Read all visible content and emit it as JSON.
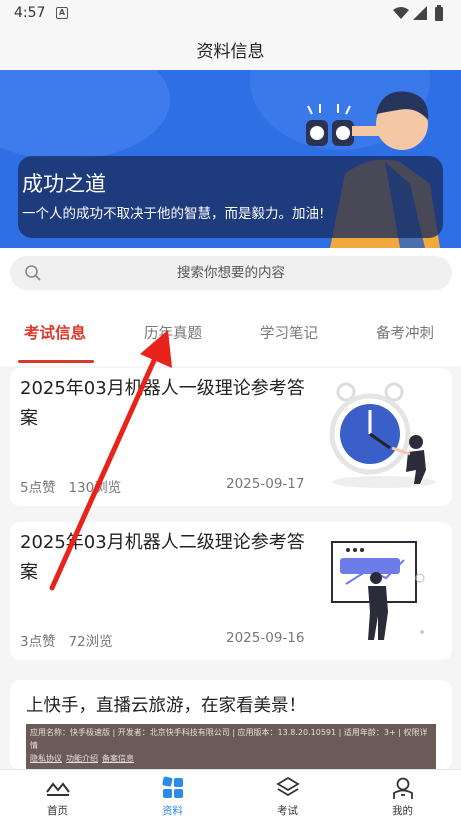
{
  "status_bar": {
    "time": "4:57",
    "notif_letter": "A"
  },
  "header": {
    "title": "资料信息"
  },
  "banner": {
    "title": "成功之道",
    "subtitle": "一个人的成功不取决于他的智慧，而是毅力。加油!"
  },
  "search": {
    "placeholder": "搜索你想要的内容"
  },
  "tabs": [
    {
      "label": "考试信息",
      "active": true
    },
    {
      "label": "历年真题",
      "active": false
    },
    {
      "label": "学习笔记",
      "active": false
    },
    {
      "label": "备考冲刺",
      "active": false
    }
  ],
  "articles": [
    {
      "title": "2025年03月机器人一级理论参考答案",
      "likes": "5点赞",
      "views": "130浏览",
      "date": "2025-09-17"
    },
    {
      "title": "2025年03月机器人二级理论参考答案",
      "likes": "3点赞",
      "views": "72浏览",
      "date": "2025-09-16"
    }
  ],
  "ad": {
    "title": "上快手，直播云旅游，在家看美景！",
    "info_line": "应用名称：快手极速版 | 开发者：北京快手科技有限公司 | 应用版本：13.8.20.10591 | 适用年龄：3+ | 权限详情",
    "links": [
      "隐私协议",
      "功能介绍",
      "备案信息"
    ]
  },
  "bottom_nav": [
    {
      "label": "首页",
      "icon": "home-icon",
      "active": false
    },
    {
      "label": "资料",
      "icon": "grid-icon",
      "active": true
    },
    {
      "label": "考试",
      "icon": "layers-icon",
      "active": false
    },
    {
      "label": "我的",
      "icon": "user-icon",
      "active": false
    }
  ],
  "colors": {
    "accent_red": "#d93a2b",
    "active_blue": "#2a8be8",
    "banner_blue": "#2f6fe6",
    "arrow_red": "#e8231c"
  }
}
